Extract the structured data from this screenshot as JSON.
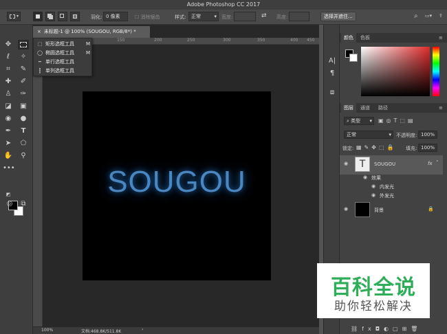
{
  "app": {
    "title": "Adobe Photoshop CC 2017"
  },
  "options": {
    "feather_label": "羽化:",
    "feather_value": "0 像素",
    "antialias_label": "消除锯齿",
    "style_label": "样式:",
    "style_value": "正常",
    "width_label": "宽度:",
    "height_label": "高度:",
    "select_subject_label": "选择并遮住..."
  },
  "document": {
    "tab_title": "未标题-1 @ 100% (SOUGOU, RGB/8*) *",
    "canvas_text": "SOUGOU",
    "zoom": "100%",
    "file_info": "文档:468.8K/511.8K"
  },
  "ruler": {
    "ticks": [
      "50",
      "100",
      "150",
      "200",
      "250",
      "300",
      "350",
      "400",
      "450"
    ]
  },
  "flyout": {
    "items": [
      {
        "label": "矩形选框工具",
        "shortcut": "M"
      },
      {
        "label": "椭圆选框工具",
        "shortcut": "M"
      },
      {
        "label": "单行选框工具",
        "shortcut": ""
      },
      {
        "label": "单列选框工具",
        "shortcut": ""
      }
    ]
  },
  "color_panel": {
    "tabs": [
      "颜色",
      "色板"
    ]
  },
  "layers_panel": {
    "tabs": [
      "图层",
      "通道",
      "路径"
    ],
    "filter_label": "类型",
    "blend_mode": "正常",
    "opacity_label": "不透明度:",
    "opacity_value": "100%",
    "lock_label": "锁定:",
    "fill_label": "填充:",
    "fill_value": "100%",
    "layers": [
      {
        "name": "SOUGOU",
        "fx": "fx"
      },
      {
        "name": "效果"
      },
      {
        "name": "内发光"
      },
      {
        "name": "外发光"
      },
      {
        "name": "背景"
      }
    ]
  },
  "watermark": {
    "title": "百科全说",
    "subtitle": "助你轻松解决"
  },
  "colors": {
    "text_glow": "#4b86be",
    "watermark_green": "#2fae5a"
  }
}
